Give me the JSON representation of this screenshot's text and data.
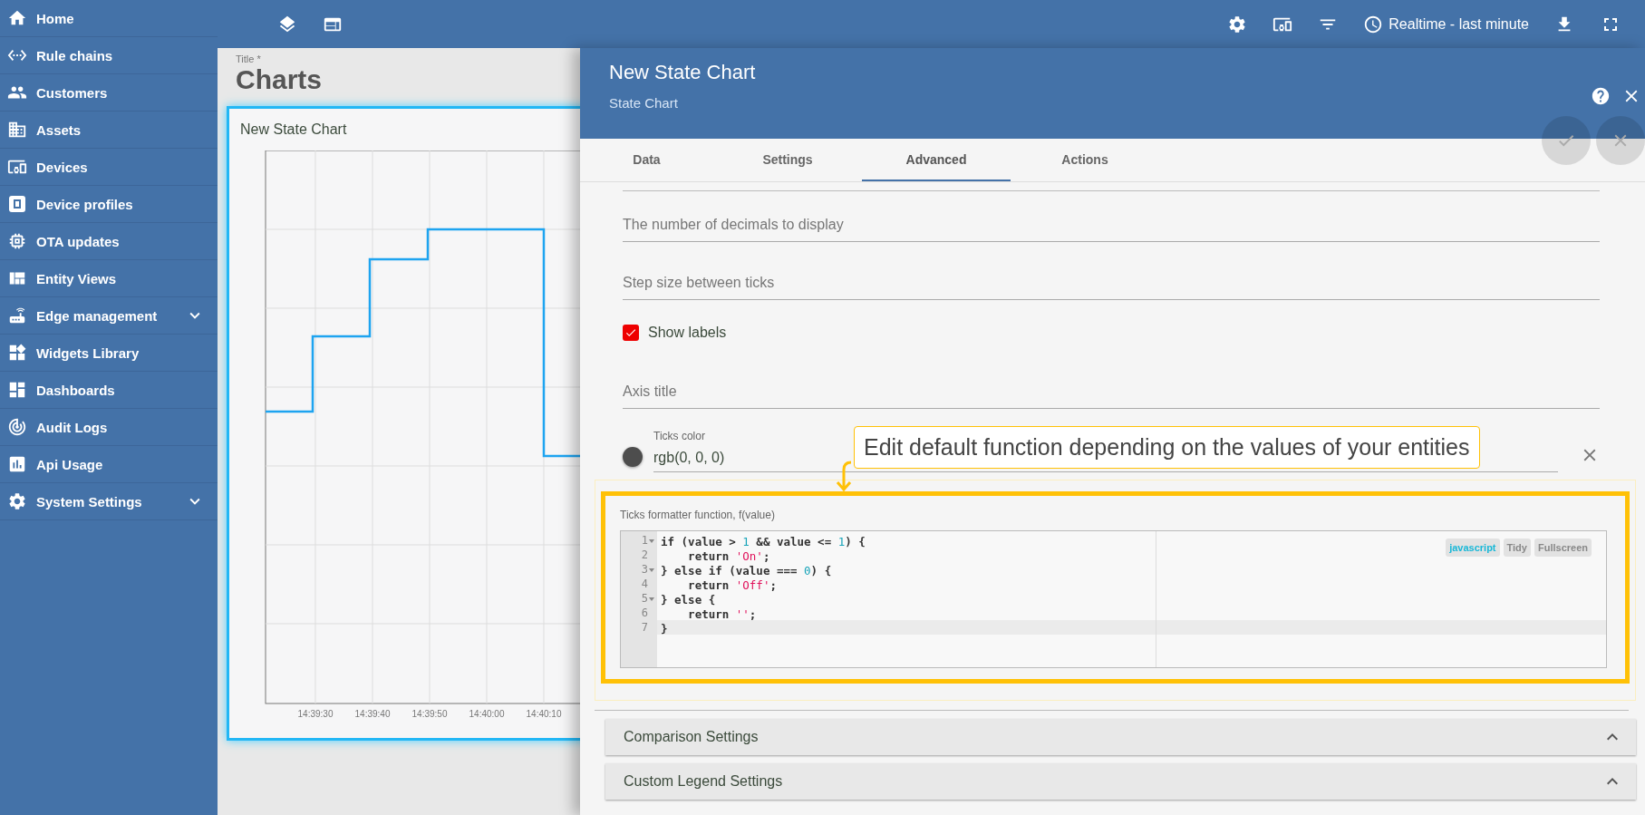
{
  "sidebar": {
    "items": [
      {
        "label": "Home",
        "expandable": false
      },
      {
        "label": "Rule chains",
        "expandable": false
      },
      {
        "label": "Customers",
        "expandable": false
      },
      {
        "label": "Assets",
        "expandable": false
      },
      {
        "label": "Devices",
        "expandable": false
      },
      {
        "label": "Device profiles",
        "expandable": false
      },
      {
        "label": "OTA updates",
        "expandable": false
      },
      {
        "label": "Entity Views",
        "expandable": false
      },
      {
        "label": "Edge management",
        "expandable": true
      },
      {
        "label": "Widgets Library",
        "expandable": false
      },
      {
        "label": "Dashboards",
        "expandable": false
      },
      {
        "label": "Audit Logs",
        "expandable": false
      },
      {
        "label": "Api Usage",
        "expandable": false
      },
      {
        "label": "System Settings",
        "expandable": true
      }
    ]
  },
  "toolbar": {
    "timewindow": "Realtime - last minute"
  },
  "dashboard": {
    "title_label": "Title *",
    "title": "Charts"
  },
  "widget": {
    "title": "New State Chart",
    "x_ticks": [
      "14:39:30",
      "14:39:40",
      "14:39:50",
      "14:40:00",
      "14:40:10"
    ]
  },
  "dialog": {
    "title": "New State Chart",
    "subtitle": "State Chart",
    "tabs": [
      {
        "label": "Data",
        "selected": false
      },
      {
        "label": "Settings",
        "selected": false
      },
      {
        "label": "Advanced",
        "selected": true
      },
      {
        "label": "Actions",
        "selected": false
      }
    ],
    "fields": [
      {
        "kind": "input",
        "placeholder": "The number of decimals to display"
      },
      {
        "kind": "input",
        "placeholder": "Step size between ticks"
      },
      {
        "kind": "checkbox",
        "label": "Show labels",
        "checked": true
      },
      {
        "kind": "input",
        "placeholder": "Axis title"
      },
      {
        "kind": "color",
        "label": "Ticks color",
        "value": "rgb(0, 0, 0)"
      }
    ],
    "callout": "Edit default function depending on the values of your entities",
    "code_field": {
      "label": "Ticks formatter function, f(value)",
      "buttons": [
        {
          "label": "javascript",
          "kind": "mode"
        },
        {
          "label": "Tidy",
          "kind": "action"
        },
        {
          "label": "Fullscreen",
          "kind": "action"
        }
      ],
      "lines": [
        {
          "number": "1",
          "foldable": true,
          "active": false,
          "tokens": [
            {
              "t": "if (value > ",
              "kind": "plain"
            },
            {
              "t": "1",
              "kind": "number"
            },
            {
              "t": " && value <= ",
              "kind": "plain"
            },
            {
              "t": "1",
              "kind": "number"
            },
            {
              "t": ") {",
              "kind": "plain"
            }
          ]
        },
        {
          "number": "2",
          "foldable": false,
          "active": false,
          "tokens": [
            {
              "t": "    return ",
              "kind": "plain"
            },
            {
              "t": "'On'",
              "kind": "string"
            },
            {
              "t": ";",
              "kind": "plain"
            }
          ]
        },
        {
          "number": "3",
          "foldable": true,
          "active": false,
          "tokens": [
            {
              "t": "} else if (value === ",
              "kind": "plain"
            },
            {
              "t": "0",
              "kind": "number"
            },
            {
              "t": ") {",
              "kind": "plain"
            }
          ]
        },
        {
          "number": "4",
          "foldable": false,
          "active": false,
          "tokens": [
            {
              "t": "    return ",
              "kind": "plain"
            },
            {
              "t": "'Off'",
              "kind": "string"
            },
            {
              "t": ";",
              "kind": "plain"
            }
          ]
        },
        {
          "number": "5",
          "foldable": true,
          "active": false,
          "tokens": [
            {
              "t": "} else {",
              "kind": "plain"
            }
          ]
        },
        {
          "number": "6",
          "foldable": false,
          "active": false,
          "tokens": [
            {
              "t": "    return ",
              "kind": "plain"
            },
            {
              "t": "''",
              "kind": "string"
            },
            {
              "t": ";",
              "kind": "plain"
            }
          ]
        },
        {
          "number": "7",
          "foldable": false,
          "active": true,
          "tokens": [
            {
              "t": "}",
              "kind": "plain"
            }
          ]
        }
      ]
    },
    "accordions": [
      {
        "title": "Comparison Settings"
      },
      {
        "title": "Custom Legend Settings"
      }
    ]
  }
}
